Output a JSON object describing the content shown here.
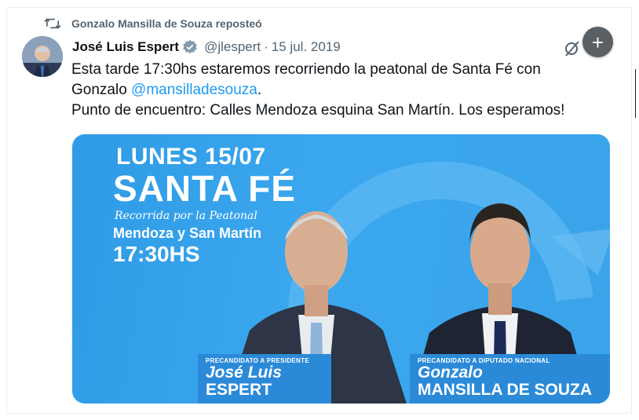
{
  "repost": {
    "label": "Gonzalo Mansilla de Souza reposteó",
    "icon": "repost-icon"
  },
  "tweet": {
    "author_name": "José Luis Espert",
    "handle": "@jlespert",
    "separator": "·",
    "date": "15 jul. 2019",
    "verified_color": "#829aab",
    "line1": "Esta tarde 17:30hs estaremos recorriendo la peatonal de Santa Fé con",
    "line2_prefix": "Gonzalo ",
    "mention": "@mansilladesouza",
    "line2_suffix": ".",
    "line3": "Punto de encuentro: Calles Mendoza esquina San Martín. Los esperamos!"
  },
  "fab": {
    "label": "+"
  },
  "media": {
    "date": "LUNES 15/07",
    "city": "SANTA FÉ",
    "tour": "Recorrida por la Peatonal",
    "place": "Mendoza y San Martín",
    "time": "17:30HS",
    "left_role": "PRECANDIDATO A PRESIDENTE",
    "left_first": "José Luis",
    "left_last": "ESPERT",
    "right_role": "PRECANDIDATO A DIPUTADO NACIONAL",
    "right_first": "Gonzalo",
    "right_last": "MANSILLA DE SOUZA"
  },
  "colors": {
    "mention": "#1d9bf0",
    "muted": "#536471",
    "banner_blue": "#3aa7ee"
  }
}
